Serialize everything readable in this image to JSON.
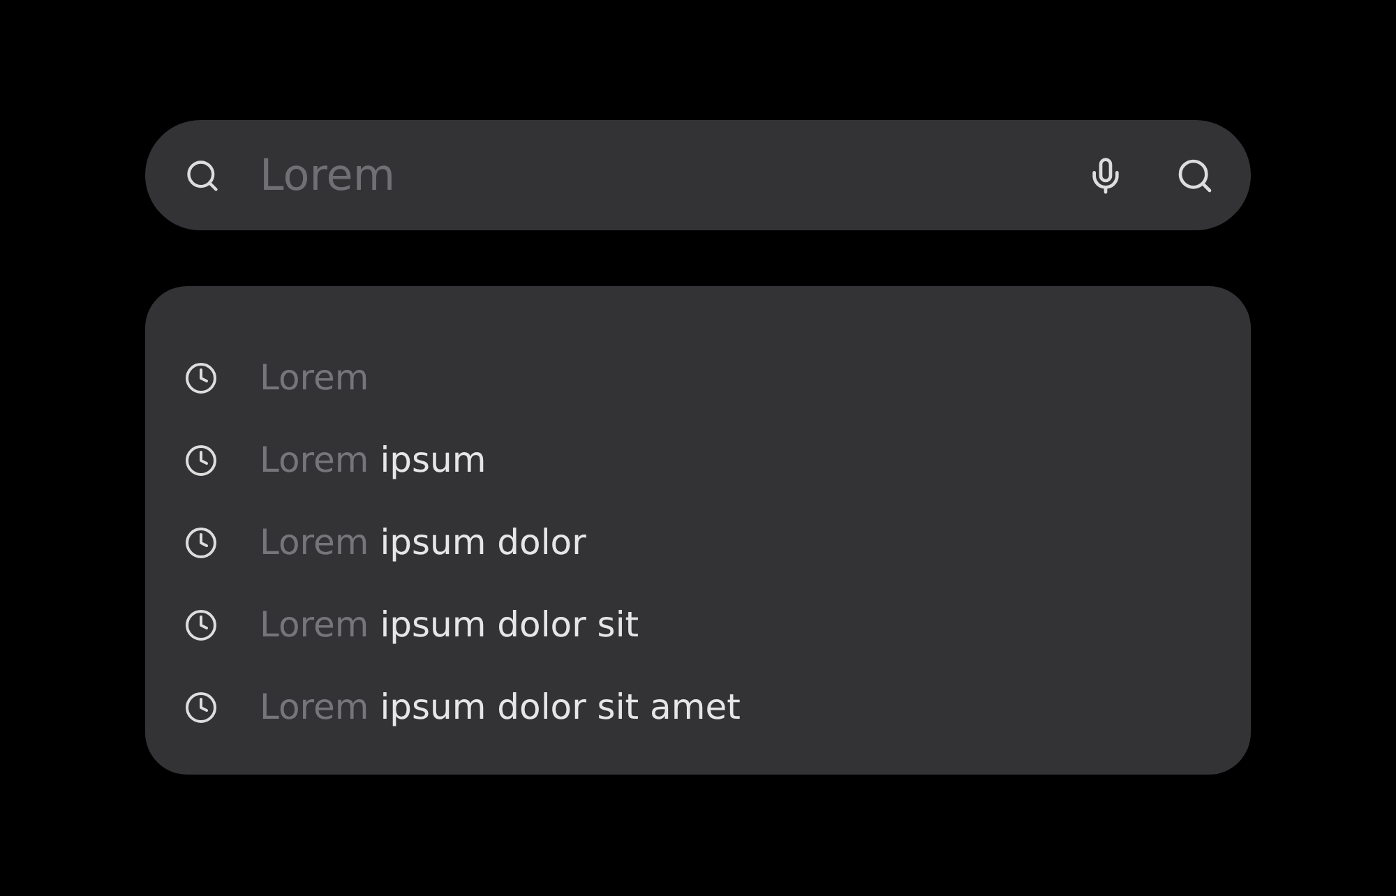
{
  "search": {
    "placeholder": "Lorem"
  },
  "suggestions": [
    {
      "typed": "Lorem"
    },
    {
      "typed": "Lorem",
      "completion": "ipsum"
    },
    {
      "typed": "Lorem",
      "completion": "ipsum dolor"
    },
    {
      "typed": "Lorem",
      "completion": "ipsum dolor sit"
    },
    {
      "typed": "Lorem",
      "completion": "ipsum dolor sit amet"
    }
  ]
}
